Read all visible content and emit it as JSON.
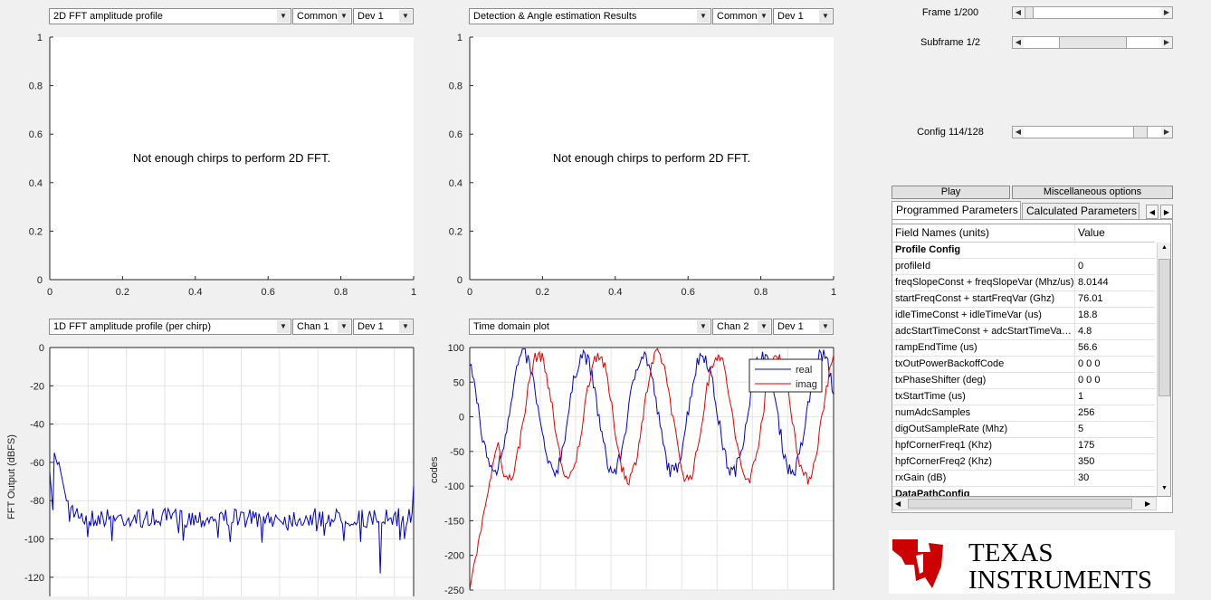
{
  "panels": {
    "p2d": {
      "title": "2D FFT amplitude profile",
      "opt1": "Common",
      "opt2": "Dev 1",
      "message": "Not enough chirps to perform 2D FFT.",
      "yticks": [
        "0",
        "0.2",
        "0.4",
        "0.6",
        "0.8",
        "1"
      ],
      "xticks": [
        "0",
        "0.2",
        "0.4",
        "0.6",
        "0.8",
        "1"
      ]
    },
    "pdet": {
      "title": "Detection & Angle estimation Results",
      "opt1": "Common",
      "opt2": "Dev 1",
      "message": "Not enough chirps to perform 2D FFT.",
      "yticks": [
        "0",
        "0.2",
        "0.4",
        "0.6",
        "0.8",
        "1"
      ],
      "xticks": [
        "0",
        "0.2",
        "0.4",
        "0.6",
        "0.8",
        "1"
      ]
    },
    "p1d": {
      "title": "1D FFT amplitude profile (per chirp)",
      "opt1": "Chan 1",
      "opt2": "Dev 1",
      "ylabel": "FFT Output (dBFS)",
      "yticks": [
        "0",
        "-20",
        "-40",
        "-60",
        "-80",
        "-100",
        "-120"
      ]
    },
    "ptd": {
      "title": "Time domain plot",
      "opt1": "Chan 2",
      "opt2": "Dev 1",
      "ylabel": "codes",
      "yticks": [
        "100",
        "50",
        "0",
        "-50",
        "-100",
        "-150",
        "-200",
        "-250"
      ],
      "legend": [
        "real",
        "imag"
      ]
    }
  },
  "controls": {
    "frame_label": "Frame 1/200",
    "frame_value": 0.01,
    "subframe_label": "Subframe 1/2",
    "subframe_value": 0.5,
    "config_label": "Config 114/128",
    "config_value": 0.89,
    "play_label": "Play",
    "misc_label": "Miscellaneous options"
  },
  "tabs": {
    "active": "Programmed Parameters",
    "other": "Calculated Parameters"
  },
  "table": {
    "header": [
      "Field Names   (units)",
      "Value"
    ],
    "rows": [
      {
        "name": "Profile Config",
        "value": "",
        "group": true
      },
      {
        "name": "profileId",
        "value": "0"
      },
      {
        "name": "freqSlopeConst + freqSlopeVar (Mhz/us)",
        "value": "8.0144"
      },
      {
        "name": "startFreqConst + startFreqVar (Ghz)",
        "value": "76.01"
      },
      {
        "name": "idleTimeConst + idleTimeVar (us)",
        "value": "18.8"
      },
      {
        "name": "adcStartTimeConst + adcStartTimeVar ...",
        "value": "4.8"
      },
      {
        "name": "rampEndTime (us)",
        "value": "56.6"
      },
      {
        "name": "txOutPowerBackoffCode",
        "value": "0 0 0"
      },
      {
        "name": "txPhaseShifter (deg)",
        "value": "0 0 0"
      },
      {
        "name": "txStartTime (us)",
        "value": "1"
      },
      {
        "name": "numAdcSamples",
        "value": "256"
      },
      {
        "name": "digOutSampleRate (Mhz)",
        "value": "5"
      },
      {
        "name": "hpfCornerFreq1 (Khz)",
        "value": "175"
      },
      {
        "name": "hpfCornerFreq2 (Khz)",
        "value": "350"
      },
      {
        "name": "rxGain (dB)",
        "value": "30"
      },
      {
        "name": "DataPathConfig",
        "value": "",
        "group": true
      }
    ]
  },
  "logo": {
    "line1": "TEXAS",
    "line2": "INSTRUMENTS",
    "color": "#cc0000"
  },
  "colors": {
    "real": "#0000cc",
    "imag": "#e00000",
    "fft": "#0000cc"
  }
}
